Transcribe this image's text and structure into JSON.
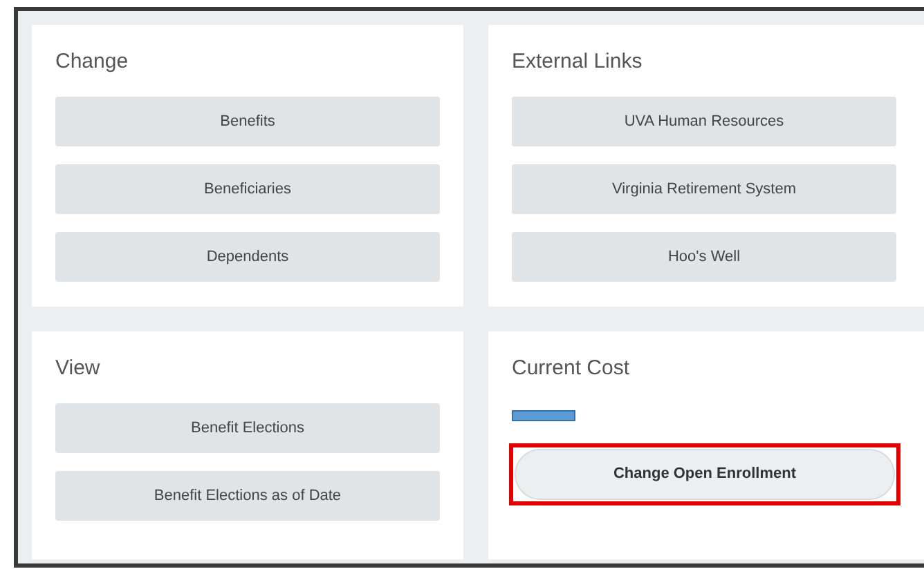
{
  "cards": [
    {
      "title": "Change",
      "kind": "links",
      "buttons": [
        {
          "label": "Benefits"
        },
        {
          "label": "Beneficiaries"
        },
        {
          "label": "Dependents"
        }
      ]
    },
    {
      "title": "External Links",
      "kind": "links",
      "buttons": [
        {
          "label": "UVA Human Resources"
        },
        {
          "label": "Virginia Retirement System"
        },
        {
          "label": "Hoo's Well"
        }
      ]
    },
    {
      "title": "View",
      "kind": "links",
      "buttons": [
        {
          "label": "Benefit Elections"
        },
        {
          "label": "Benefit Elections as of Date"
        }
      ]
    },
    {
      "title": "Current Cost",
      "kind": "cost",
      "amount_hidden": true,
      "action": {
        "label": "Change Open Enrollment",
        "highlighted": true
      }
    }
  ]
}
